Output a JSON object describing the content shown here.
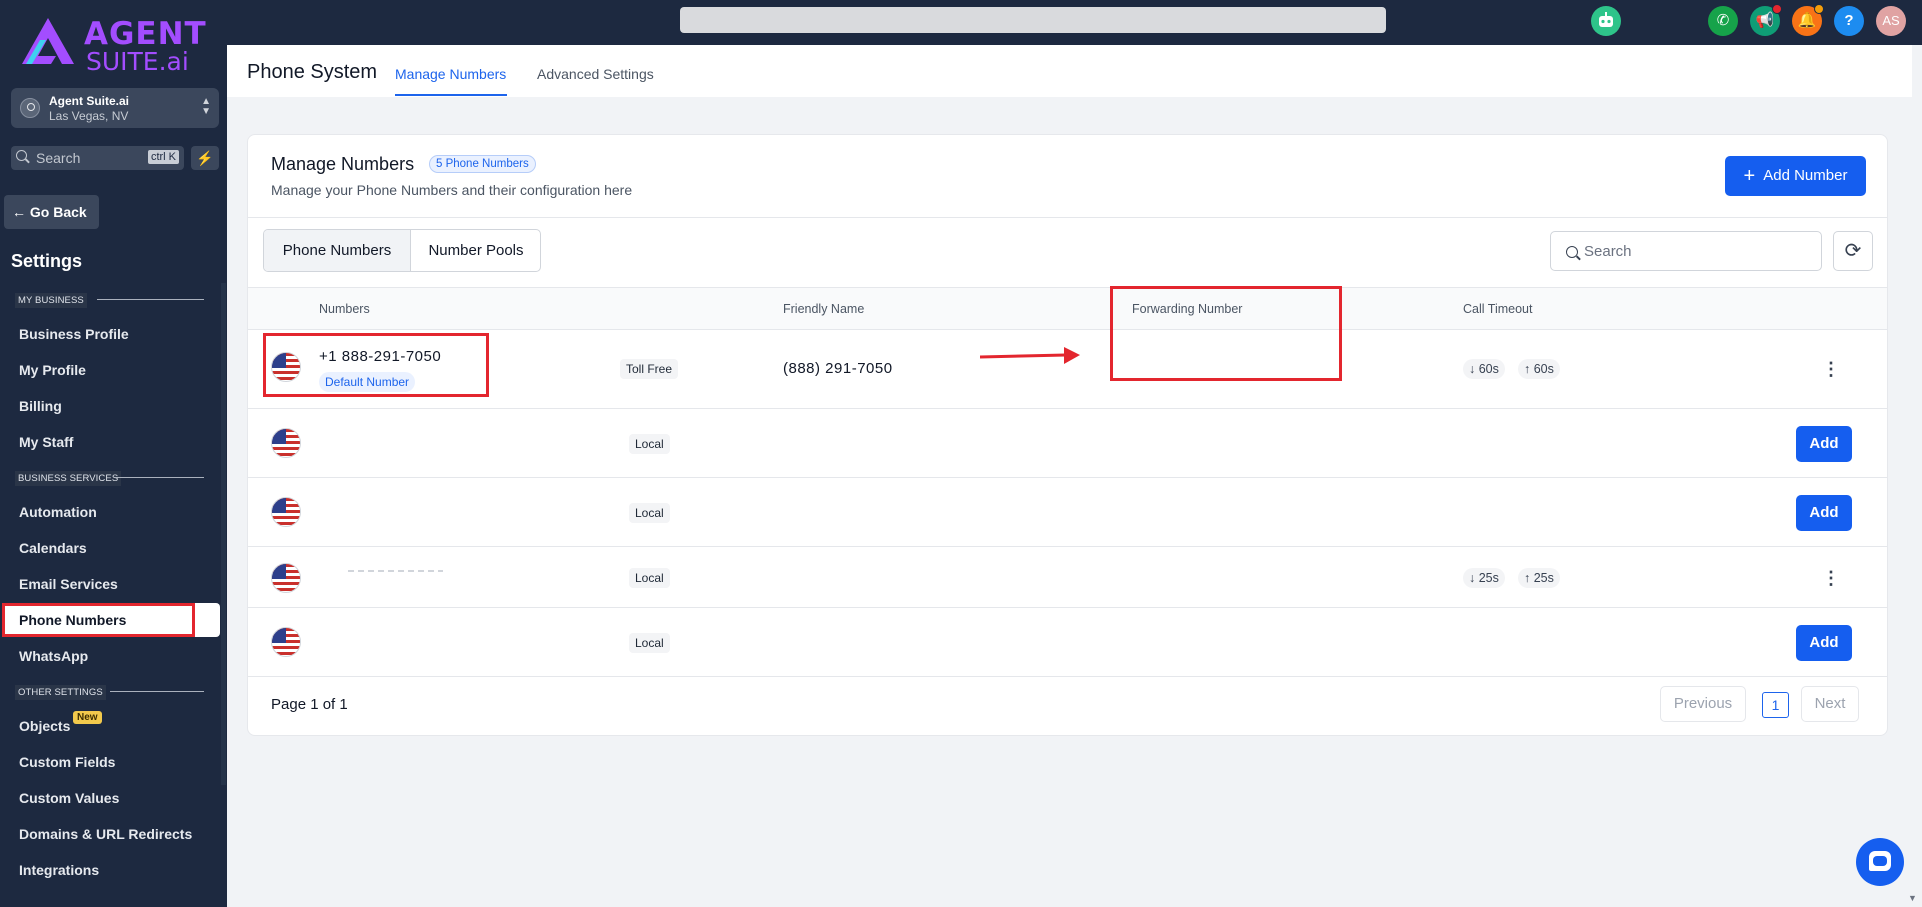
{
  "brand": {
    "line1": "AGENT",
    "line2": "SUITE.ai"
  },
  "location": {
    "name": "Agent Suite.ai",
    "city": "Las Vegas, NV"
  },
  "sidebar_search": {
    "placeholder": "Search",
    "shortcut": "ctrl K"
  },
  "go_back": "← Go Back",
  "settings_heading": "Settings",
  "sections": {
    "my_business": "MY BUSINESS",
    "business_services": "BUSINESS SERVICES",
    "other_settings": "OTHER SETTINGS"
  },
  "nav": {
    "business_profile": "Business Profile",
    "my_profile": "My Profile",
    "billing": "Billing",
    "my_staff": "My Staff",
    "automation": "Automation",
    "calendars": "Calendars",
    "email_services": "Email Services",
    "phone_numbers": "Phone Numbers",
    "whatsapp": "WhatsApp",
    "objects": "Objects",
    "objects_badge": "New",
    "custom_fields": "Custom Fields",
    "custom_values": "Custom Values",
    "domains": "Domains & URL Redirects",
    "integrations": "Integrations"
  },
  "topbar": {
    "avatar": "AS",
    "help": "?"
  },
  "header": {
    "title": "Phone System",
    "tab_manage": "Manage Numbers",
    "tab_advanced": "Advanced Settings"
  },
  "card": {
    "title": "Manage Numbers",
    "badge": "5 Phone Numbers",
    "subtitle": "Manage your Phone Numbers and their configuration here",
    "add_button": "Add Number"
  },
  "segments": {
    "phone_numbers": "Phone Numbers",
    "number_pools": "Number Pools"
  },
  "table_search": {
    "placeholder": "Search"
  },
  "columns": {
    "numbers": "Numbers",
    "friendly_name": "Friendly Name",
    "forwarding_number": "Forwarding Number",
    "call_timeout": "Call Timeout"
  },
  "rows": [
    {
      "number": "+1 888-291-7050",
      "default_badge": "Default Number",
      "type": "Toll Free",
      "friendly_name": "(888) 291-7050",
      "timeout_in": "60s",
      "timeout_out": "60s"
    },
    {
      "type": "Local",
      "action": "Add"
    },
    {
      "type": "Local",
      "action": "Add"
    },
    {
      "type": "Local",
      "timeout_in": "25s",
      "timeout_out": "25s"
    },
    {
      "type": "Local",
      "action": "Add"
    }
  ],
  "pagination": {
    "label": "Page 1 of 1",
    "previous": "Previous",
    "current": "1",
    "next": "Next"
  },
  "colors": {
    "primary": "#155eef",
    "sidebar_bg": "#1d2940",
    "annotation_red": "#e3262e",
    "brand_purple": "#a34dff"
  }
}
